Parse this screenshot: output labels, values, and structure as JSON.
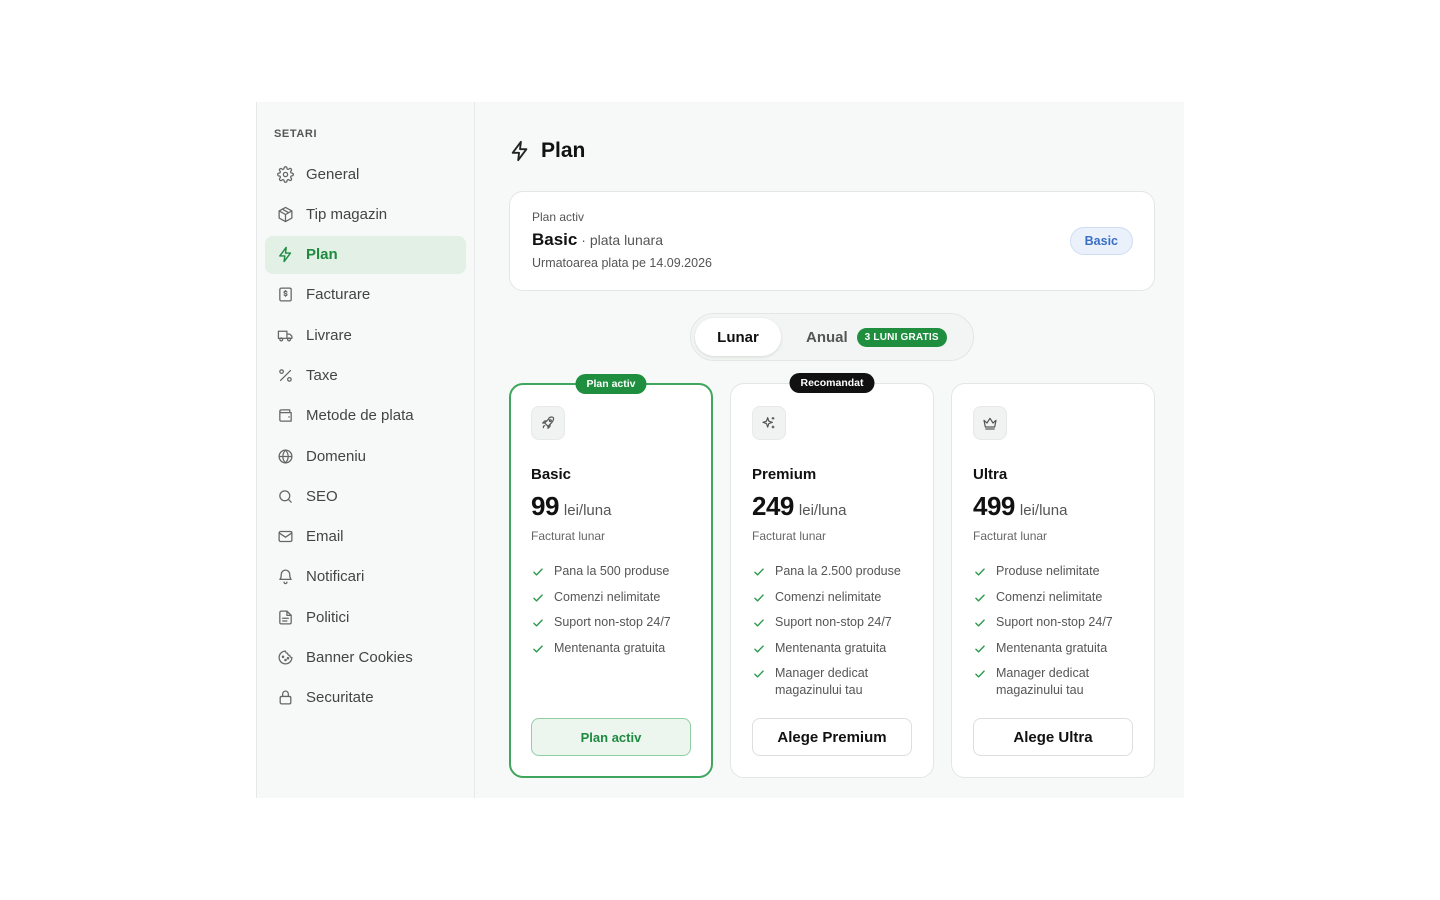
{
  "sidebar": {
    "heading": "SETARI",
    "items": [
      {
        "key": "general",
        "label": "General",
        "icon": "gear-icon"
      },
      {
        "key": "tip-magazin",
        "label": "Tip magazin",
        "icon": "box-icon"
      },
      {
        "key": "plan",
        "label": "Plan",
        "icon": "lightning-icon",
        "active": true
      },
      {
        "key": "facturare",
        "label": "Facturare",
        "icon": "invoice-icon"
      },
      {
        "key": "livrare",
        "label": "Livrare",
        "icon": "truck-icon"
      },
      {
        "key": "taxe",
        "label": "Taxe",
        "icon": "percent-icon"
      },
      {
        "key": "metode-plata",
        "label": "Metode de plata",
        "icon": "wallet-icon"
      },
      {
        "key": "domeniu",
        "label": "Domeniu",
        "icon": "globe-icon"
      },
      {
        "key": "seo",
        "label": "SEO",
        "icon": "search-icon"
      },
      {
        "key": "email",
        "label": "Email",
        "icon": "mail-icon"
      },
      {
        "key": "notificari",
        "label": "Notificari",
        "icon": "bell-icon"
      },
      {
        "key": "politici",
        "label": "Politici",
        "icon": "document-icon"
      },
      {
        "key": "banner-cookies",
        "label": "Banner Cookies",
        "icon": "cookie-icon"
      },
      {
        "key": "securitate",
        "label": "Securitate",
        "icon": "lock-icon"
      }
    ]
  },
  "header": {
    "title": "Plan",
    "icon": "lightning-icon"
  },
  "active_plan": {
    "label": "Plan activ",
    "name": "Basic",
    "billing": "· plata lunara",
    "next_payment": "Urmatoarea plata pe 14.09.2026",
    "badge": "Basic"
  },
  "billing_toggle": {
    "monthly": "Lunar",
    "yearly": "Anual",
    "promo": "3 LUNI GRATIS",
    "selected": "monthly"
  },
  "plans": [
    {
      "name": "Basic",
      "icon": "rocket-icon",
      "ribbon": "Plan activ",
      "price": "99",
      "unit": "lei/luna",
      "billing": "Facturat lunar",
      "features": [
        "Pana la 500 produse",
        "Comenzi nelimitate",
        "Suport non-stop 24/7",
        "Mentenanta gratuita"
      ],
      "cta": "Plan activ",
      "current": true
    },
    {
      "name": "Premium",
      "icon": "sparkles-icon",
      "ribbon": "Recomandat",
      "price": "249",
      "unit": "lei/luna",
      "billing": "Facturat lunar",
      "features": [
        "Pana la 2.500 produse",
        "Comenzi nelimitate",
        "Suport non-stop 24/7",
        "Mentenanta gratuita",
        "Manager dedicat magazinului tau"
      ],
      "cta": "Alege Premium",
      "current": false
    },
    {
      "name": "Ultra",
      "icon": "crown-icon",
      "ribbon": "",
      "price": "499",
      "unit": "lei/luna",
      "billing": "Facturat lunar",
      "features": [
        "Produse nelimitate",
        "Comenzi nelimitate",
        "Suport non-stop 24/7",
        "Mentenanta gratuita",
        "Manager dedicat magazinului tau"
      ],
      "cta": "Alege Ultra",
      "current": false
    }
  ],
  "colors": {
    "accent": "#1d8a3f",
    "accent_bg": "#e2f0e6",
    "badge_blue": "#3a6fc4",
    "ribbon_black": "#111111"
  }
}
